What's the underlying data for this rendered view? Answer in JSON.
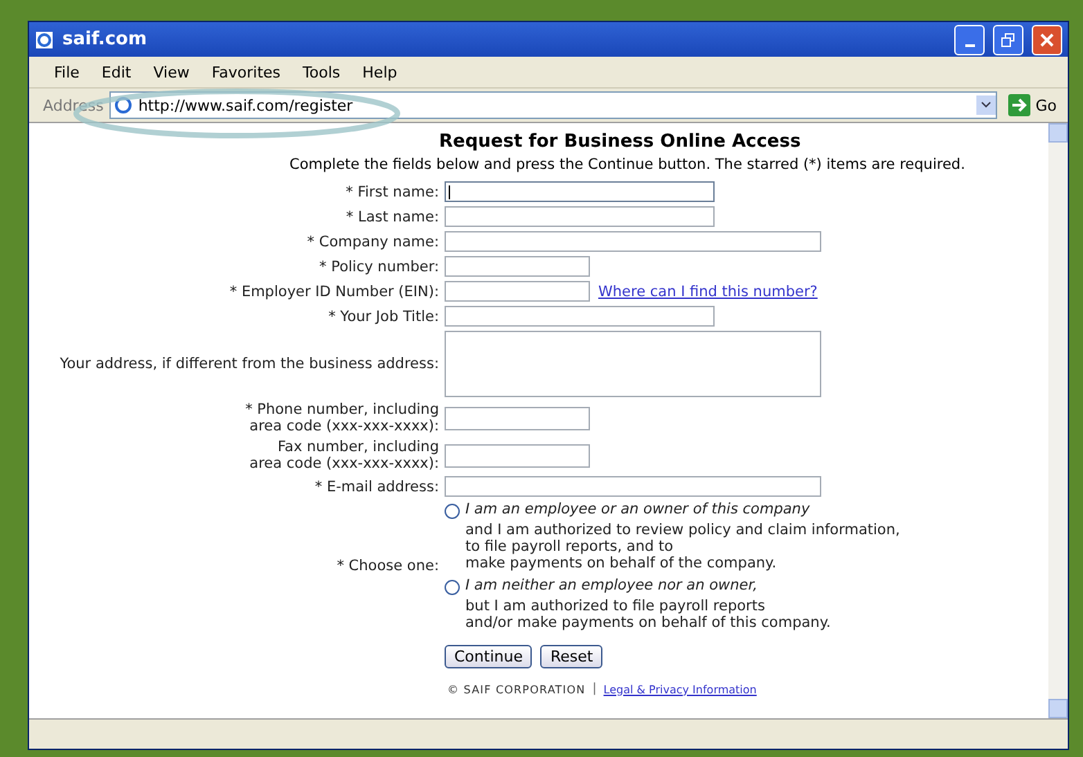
{
  "window": {
    "title": "saif.com"
  },
  "menu": [
    "File",
    "Edit",
    "View",
    "Favorites",
    "Tools",
    "Help"
  ],
  "address_bar": {
    "label": "Address",
    "url": "http://www.saif.com/register",
    "go": "Go"
  },
  "form": {
    "title": "Request for Business Online Access",
    "intro": "Complete the fields below and press the Continue button. The starred (*) items are required.",
    "fields": [
      {
        "label": "* First name:",
        "kind": "medium",
        "focused": true
      },
      {
        "label": "* Last name:",
        "kind": "medium",
        "focused": false
      },
      {
        "label": "* Company name:",
        "kind": "long",
        "focused": false
      },
      {
        "label": "* Policy number:",
        "kind": "short",
        "focused": false
      },
      {
        "label": "* Employer ID Number (EIN):",
        "kind": "short",
        "focused": false,
        "link": "Where can I find this number?"
      },
      {
        "label": "* Your Job Title:",
        "kind": "medium",
        "focused": false
      },
      {
        "label": "Your address, if different from the business address:",
        "kind": "textarea",
        "focused": false
      },
      {
        "label": "* Phone number, including",
        "hint": "area code (xxx-xxx-xxxx):",
        "kind": "short",
        "focused": false
      },
      {
        "label": "Fax number, including",
        "hint": "area code (xxx-xxx-xxxx):",
        "kind": "short",
        "focused": false
      },
      {
        "label": "* E-mail address:",
        "kind": "long",
        "focused": false
      }
    ],
    "choice": {
      "label": "* Choose one:",
      "options": [
        {
          "heading": "I am an employee or an owner of this company",
          "lines": [
            "and I am authorized to review policy and claim information,",
            "to file payroll reports, and to",
            "make payments on behalf of the company."
          ],
          "selected": false
        },
        {
          "heading": "I am neither an employee nor an owner,",
          "lines": [
            "but I am authorized to file payroll reports",
            "and/or make payments on behalf of this company."
          ],
          "selected": false
        }
      ]
    },
    "buttons": [
      "Continue",
      "Reset"
    ],
    "footer": {
      "copyright": "© SAIF CORPORATION",
      "separator": "|",
      "link": "Legal & Privacy Information"
    }
  }
}
